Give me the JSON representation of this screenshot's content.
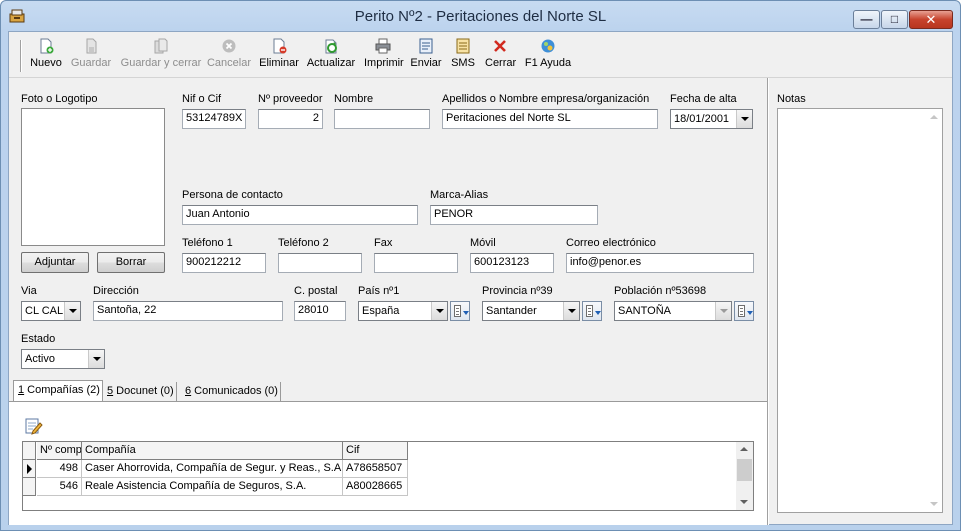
{
  "window": {
    "title": "Perito Nº2 - Peritaciones del Norte SL"
  },
  "toolbar": {
    "nuevo": "Nuevo",
    "guardar": "Guardar",
    "guardar_cerrar": "Guardar y cerrar",
    "cancelar": "Cancelar",
    "eliminar": "Eliminar",
    "actualizar": "Actualizar",
    "imprimir": "Imprimir",
    "enviar": "Enviar",
    "sms": "SMS",
    "cerrar": "Cerrar",
    "ayuda": "F1 Ayuda"
  },
  "form": {
    "foto": {
      "label": "Foto o Logotipo",
      "adjuntar": "Adjuntar",
      "borrar": "Borrar"
    },
    "nif": {
      "label": "Nif o Cif",
      "value": "53124789X"
    },
    "proveedor": {
      "label": "Nº proveedor",
      "value": "2"
    },
    "nombre": {
      "label": "Nombre",
      "value": ""
    },
    "apellidos": {
      "label": "Apellidos o Nombre empresa/organización",
      "value": "Peritaciones del Norte SL"
    },
    "fecha_alta": {
      "label": "Fecha de alta",
      "value": "18/01/2001"
    },
    "contacto": {
      "label": "Persona de contacto",
      "value": "Juan Antonio"
    },
    "marca": {
      "label": "Marca-Alias",
      "value": "PENOR"
    },
    "telefono1": {
      "label": "Teléfono 1",
      "value": "900212212"
    },
    "telefono2": {
      "label": "Teléfono 2",
      "value": ""
    },
    "fax": {
      "label": "Fax",
      "value": ""
    },
    "movil": {
      "label": "Móvil",
      "value": "600123123"
    },
    "correo": {
      "label": "Correo electrónico",
      "value": "info@penor.es"
    },
    "via": {
      "label": "Via",
      "value": "CL CAL"
    },
    "direccion": {
      "label": "Dirección",
      "value": "Santoña, 22"
    },
    "cpostal": {
      "label": "C. postal",
      "value": "28010"
    },
    "pais": {
      "label": "País nº1",
      "value": "España"
    },
    "provincia": {
      "label": "Provincia nº39",
      "value": "Santander"
    },
    "poblacion": {
      "label": "Población nº53698",
      "value": "SANTOÑA"
    },
    "estado": {
      "label": "Estado",
      "value": "Activo"
    }
  },
  "notes": {
    "label": "Notas"
  },
  "tabs": [
    {
      "key": "1",
      "rest": " Compañías (2)"
    },
    {
      "key": "5",
      "rest": " Docunet (0)"
    },
    {
      "key": "6",
      "rest": " Comunicados (0)"
    }
  ],
  "grid": {
    "headers": [
      "Nº comp",
      "Compañía",
      "Cif"
    ],
    "rows": [
      {
        "num": "498",
        "compania": "Caser Ahorrovida, Compañía de Segur. y Reas., S.A.",
        "cif": "A78658507"
      },
      {
        "num": "546",
        "compania": "Reale Asistencia Compañía de Seguros, S.A.",
        "cif": "A80028665"
      }
    ]
  }
}
